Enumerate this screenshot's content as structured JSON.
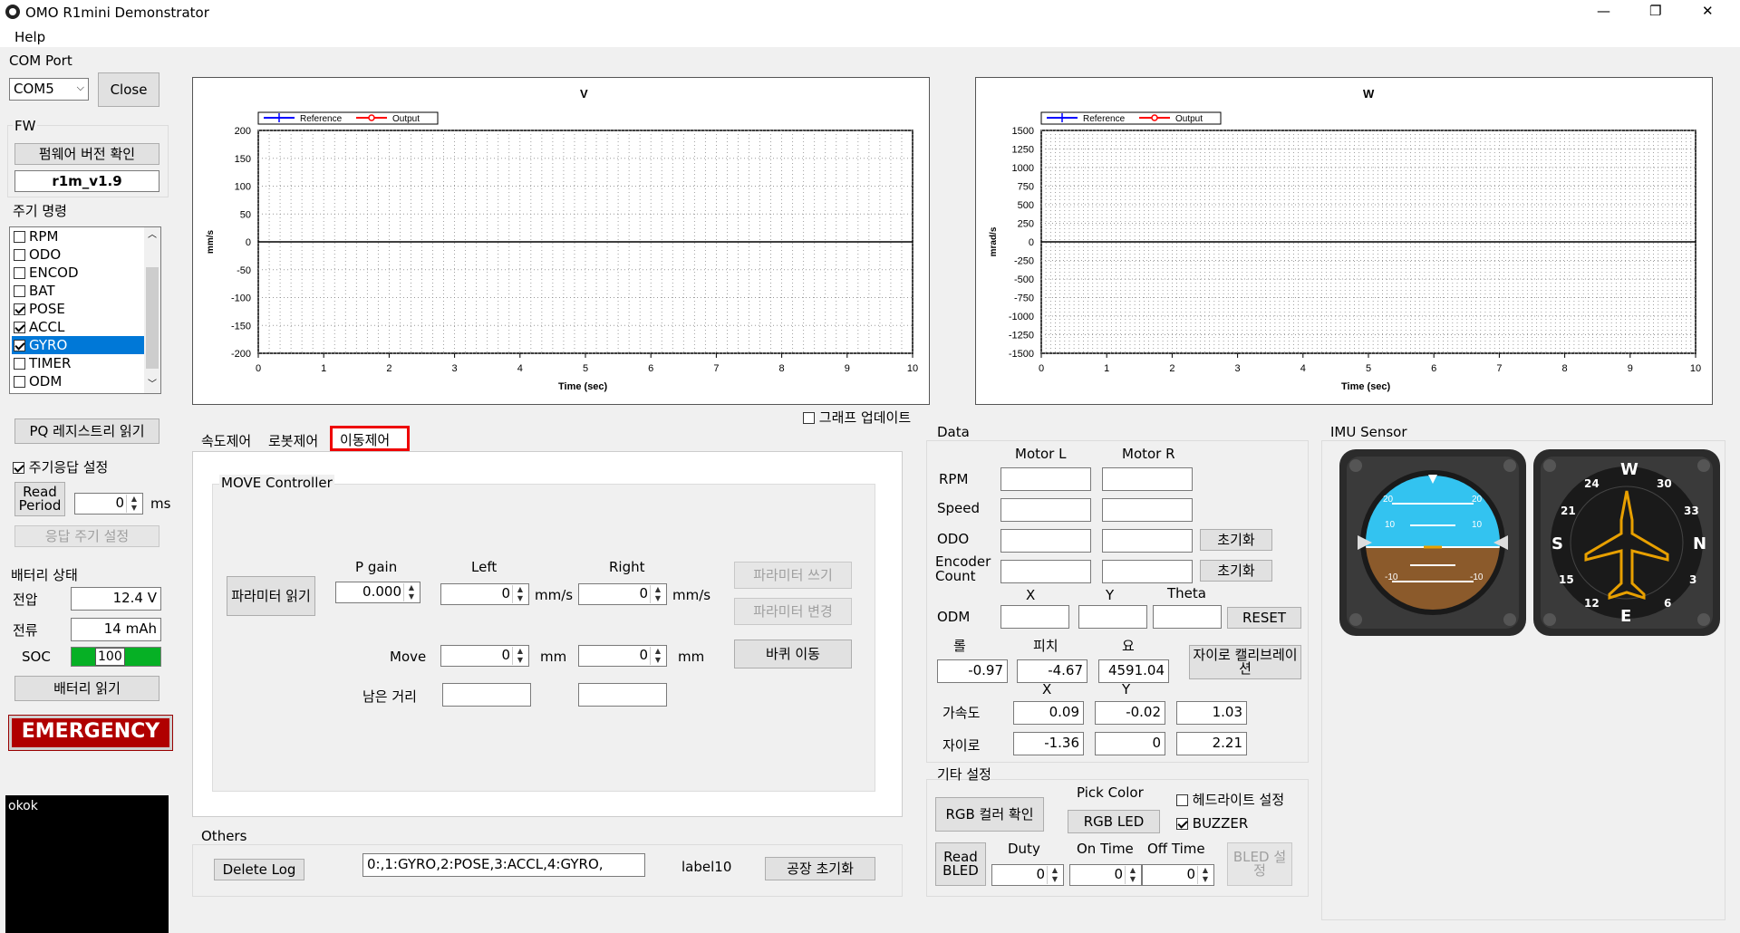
{
  "window": {
    "title": "OMO R1mini Demonstrator",
    "min": "—",
    "max": "❐",
    "close": "✕"
  },
  "menu": {
    "help": "Help"
  },
  "com": {
    "label": "COM Port",
    "port": "COM5",
    "close_btn": "Close"
  },
  "fw": {
    "label": "FW",
    "check_btn": "펌웨어 버전 확인",
    "version": "r1m_v1.9"
  },
  "periodic": {
    "label": "주기 명령",
    "items": [
      {
        "name": "RPM",
        "checked": false
      },
      {
        "name": "ODO",
        "checked": false
      },
      {
        "name": "ENCOD",
        "checked": false
      },
      {
        "name": "BAT",
        "checked": false
      },
      {
        "name": "POSE",
        "checked": true
      },
      {
        "name": "ACCL",
        "checked": true
      },
      {
        "name": "GYRO",
        "checked": true
      },
      {
        "name": "TIMER",
        "checked": false
      },
      {
        "name": "ODM",
        "checked": false
      }
    ]
  },
  "pq_btn": "PQ 레지스트리 읽기",
  "period_resp": {
    "label": "주기응답 설정",
    "read_period": "Read Period",
    "value": "0",
    "unit": "ms",
    "set_btn": "응답 주기 설정"
  },
  "battery": {
    "label": "배터리 상태",
    "voltage_label": "전압",
    "voltage": "12.4 V",
    "current_label": "전류",
    "current": "14 mAh",
    "soc_label": "SOC",
    "soc": "100",
    "soc_value": 100,
    "read_btn": "배터리 읽기"
  },
  "emergency": "EMERGENCY",
  "console": "okok",
  "chart_data": [
    {
      "type": "line",
      "title": "V",
      "xlabel": "Time (sec)",
      "ylabel": "mm/s",
      "xlim": [
        0,
        10
      ],
      "ylim": [
        -200,
        200
      ],
      "xticks": [
        "0",
        "1",
        "2",
        "3",
        "4",
        "5",
        "6",
        "7",
        "8",
        "9",
        "10"
      ],
      "yticks": [
        "200",
        "150",
        "100",
        "50",
        "0",
        "-50",
        "-100",
        "-150",
        "-200"
      ],
      "series": [
        {
          "name": "Reference",
          "color": "#0000ff",
          "values": []
        },
        {
          "name": "Output",
          "color": "#ff0000",
          "values": []
        }
      ],
      "grid": true,
      "legend": "top-left"
    },
    {
      "type": "line",
      "title": "W",
      "xlabel": "Time (sec)",
      "ylabel": "mrad/s",
      "xlim": [
        0,
        10
      ],
      "ylim": [
        -1500,
        1500
      ],
      "xticks": [
        "0",
        "1",
        "2",
        "3",
        "4",
        "5",
        "6",
        "7",
        "8",
        "9",
        "10"
      ],
      "yticks": [
        "1500",
        "1250",
        "1000",
        "750",
        "500",
        "250",
        "0",
        "-250",
        "-500",
        "-750",
        "-1000",
        "-1250",
        "-1500"
      ],
      "series": [
        {
          "name": "Reference",
          "color": "#0000ff",
          "values": []
        },
        {
          "name": "Output",
          "color": "#ff0000",
          "values": []
        }
      ],
      "grid": true,
      "legend": "top-left"
    }
  ],
  "graph_update": "그래프 업데이트",
  "tabs": [
    "속도제어",
    "로봇제어",
    "이동제어"
  ],
  "move": {
    "group": "MOVE Controller",
    "param_read": "파라미터 읽기",
    "pgain_label": "P gain",
    "pgain": "0.000",
    "left_label": "Left",
    "right_label": "Right",
    "left": "0",
    "right": "0",
    "mms": "mm/s",
    "move_label": "Move",
    "move_left": "0",
    "move_right": "0",
    "mm": "mm",
    "remain_label": "남은 거리",
    "param_write": "파라미터 쓰기",
    "param_change": "파라미터 변경",
    "wheel_move": "바퀴 이동"
  },
  "others": {
    "label": "Others",
    "delete_log": "Delete Log",
    "log": "0:,1:GYRO,2:POSE,3:ACCL,4:GYRO,",
    "label10": "label10",
    "factory": "공장 초기화"
  },
  "data": {
    "label": "Data",
    "motor_l": "Motor L",
    "motor_r": "Motor R",
    "rpm": "RPM",
    "speed": "Speed",
    "odo": "ODO",
    "encoder": "Encoder Count",
    "reset_kr": "초기화",
    "x": "X",
    "y": "Y",
    "theta": "Theta",
    "odm": "ODM",
    "reset": "RESET",
    "roll_label": "롤",
    "pitch_label": "피치",
    "yaw_label": "요",
    "roll": "-0.97",
    "pitch": "-4.67",
    "yaw": "4591.04",
    "gyro_cal": "자이로 캘리브레이션",
    "accel_label": "가속도",
    "ax": "0.09",
    "ay": "-0.02",
    "az": "1.03",
    "gyro_label": "자이로",
    "gx": "-1.36",
    "gy": "0",
    "gz": "2.21"
  },
  "etc": {
    "label": "기타 설정",
    "rgb_check": "RGB 컬러 확인",
    "pick_color": "Pick Color",
    "rgb_led": "RGB LED",
    "headlight": "헤드라이트 설정",
    "buzzer": "BUZZER",
    "read_bled": "Read BLED",
    "duty": "Duty",
    "on_time": "On Time",
    "off_time": "Off Time",
    "duty_v": "0",
    "on_v": "0",
    "off_v": "0",
    "bled_set": "BLED 설정"
  },
  "imu": {
    "label": "IMU Sensor",
    "att_ticks": [
      "20",
      "10",
      "10",
      "-10",
      "20",
      "10",
      "-10"
    ],
    "heading": [
      "W",
      "24",
      "30",
      "21",
      "33",
      "S",
      "N",
      "15",
      "3",
      "12",
      "E",
      "6"
    ]
  }
}
